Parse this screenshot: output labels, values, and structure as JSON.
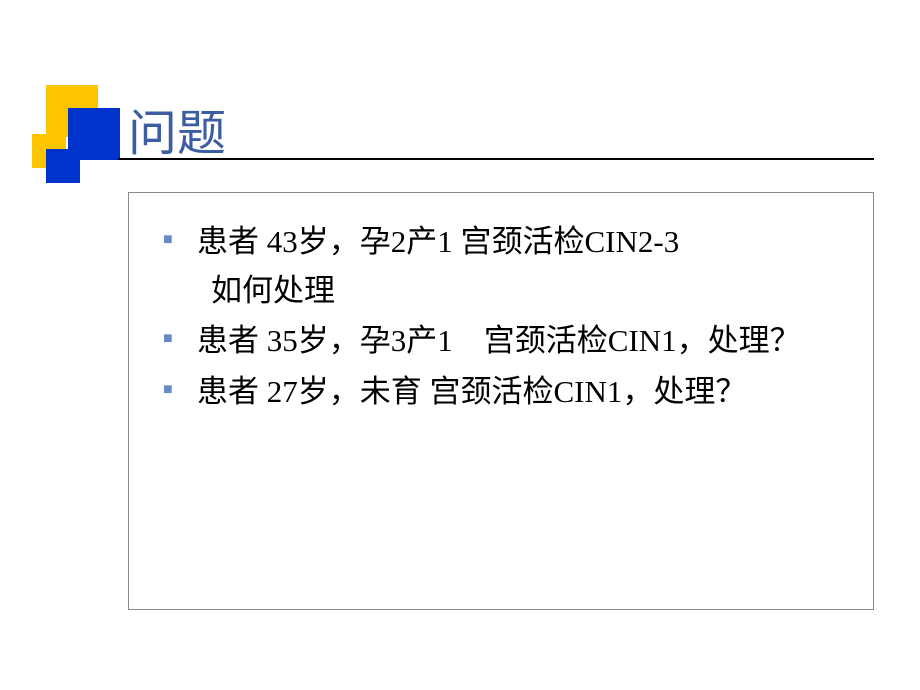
{
  "title": "问题",
  "items": [
    {
      "main": "患者  43岁，孕2产1 宫颈活检CIN2-3",
      "sub": "如何处理"
    },
    {
      "main": "患者  35岁，孕3产1　宫颈活检CIN1，处理？",
      "sub": ""
    },
    {
      "main": "患者  27岁，未育  宫颈活检CIN1，处理？",
      "sub": ""
    }
  ]
}
